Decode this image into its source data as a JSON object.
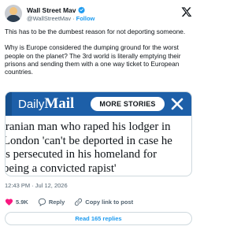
{
  "author": {
    "display_name": "Wall Street Mav",
    "handle": "@WallStreetMav",
    "separator": "·",
    "follow_label": "Follow",
    "verified_color": "#1d9bf0"
  },
  "tweet": {
    "paragraphs": [
      "This has to be the dumbest reason for not deporting someone.",
      "Why is Europe considered the dumping ground for the worst people on the planet? The 3rd world is literally emptying their prisons and sending them with a one way ticket to European countries."
    ]
  },
  "media": {
    "logo_daily": "Daily",
    "logo_mail": "Mail",
    "more_stories_label": "MORE STORIES",
    "brand_color": "#1d5fa8",
    "headline_lines": [
      "Iranian man who raped his lodger in",
      "London 'can't be deported in case he",
      "is persecuted in his homeland for",
      "being a convicted rapist'"
    ]
  },
  "timestamp": "12:43 PM · Jul 12, 2026",
  "actions": {
    "likes_count": "5.9K",
    "reply_label": "Reply",
    "copy_link_label": "Copy link to post",
    "like_color": "#f91880"
  },
  "replies_button_label": "Read 165 replies"
}
